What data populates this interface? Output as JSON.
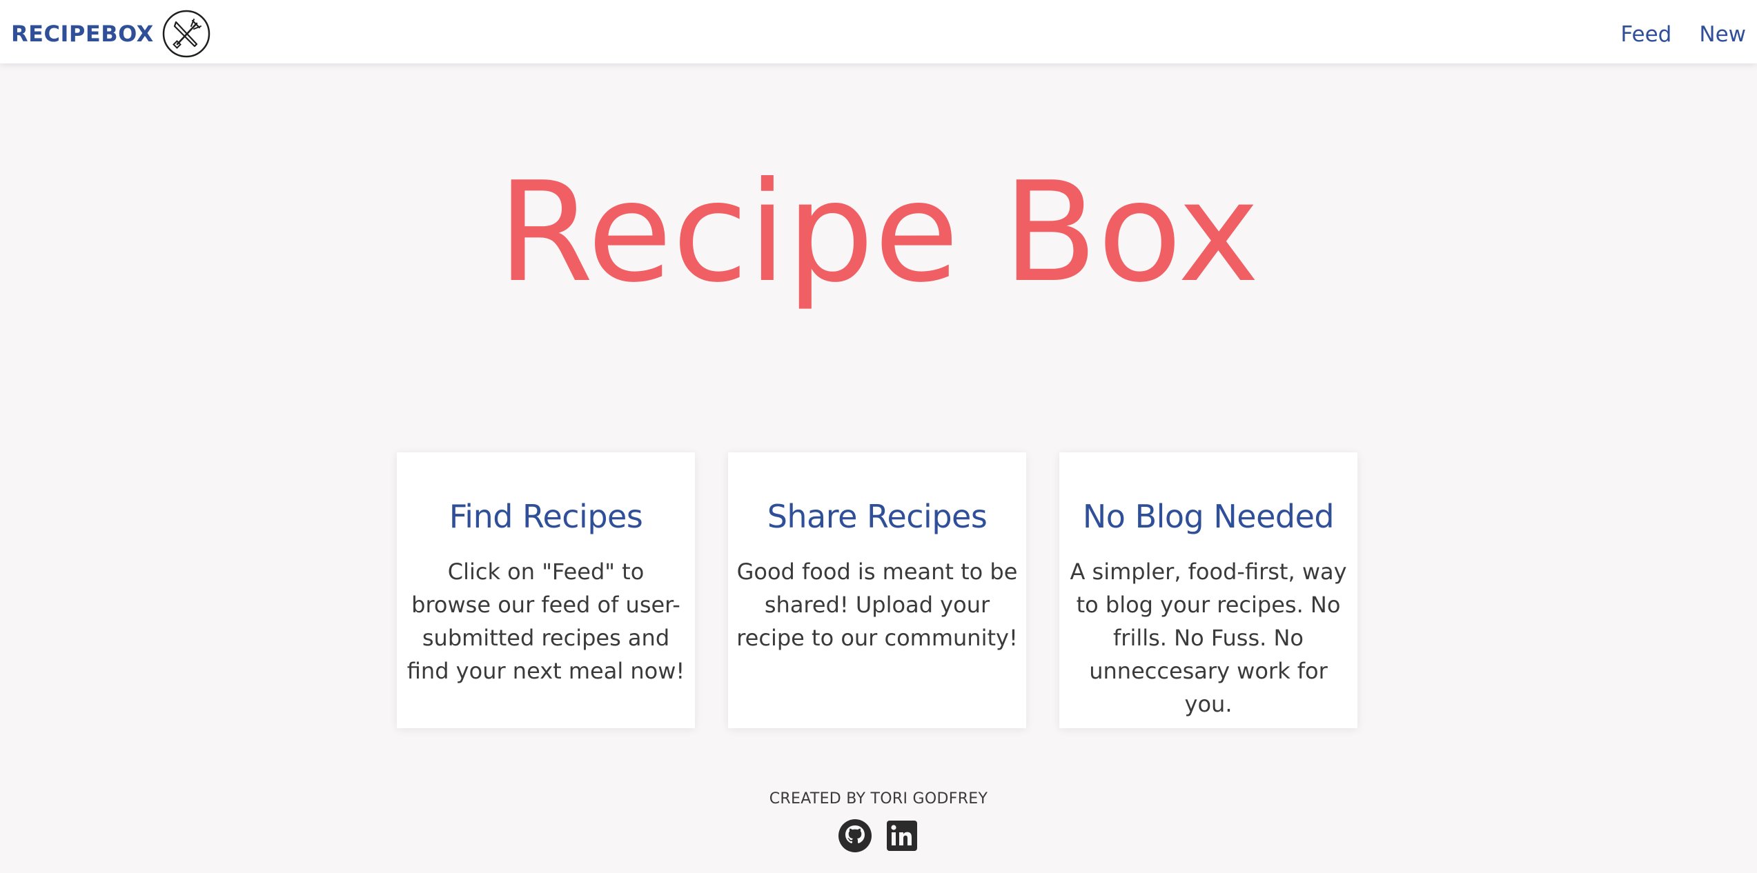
{
  "navbar": {
    "brand": "RECIPEBOX",
    "logo_icon": "fork-knife-icon",
    "links": [
      {
        "label": "Feed"
      },
      {
        "label": "New"
      }
    ]
  },
  "hero": {
    "title": "Recipe Box"
  },
  "cards": [
    {
      "title": "Find Recipes",
      "body": "Click on \"Feed\" to browse our feed of user-submitted recipes and find your next meal now!"
    },
    {
      "title": "Share Recipes",
      "body": "Good food is meant to be shared! Upload your recipe to our community!"
    },
    {
      "title": "No Blog Needed",
      "body": "A simpler, food-first, way to blog your recipes. No frills. No Fuss. No unneccesary work for you."
    }
  ],
  "footer": {
    "credit": "CREATED BY TORI GODFREY",
    "social_icons": [
      "github-icon",
      "linkedin-icon"
    ]
  },
  "colors": {
    "brand": "#2f4f99",
    "hero": "#ef5f63",
    "background": "#f8f6f7",
    "text": "#3a3a3a"
  }
}
